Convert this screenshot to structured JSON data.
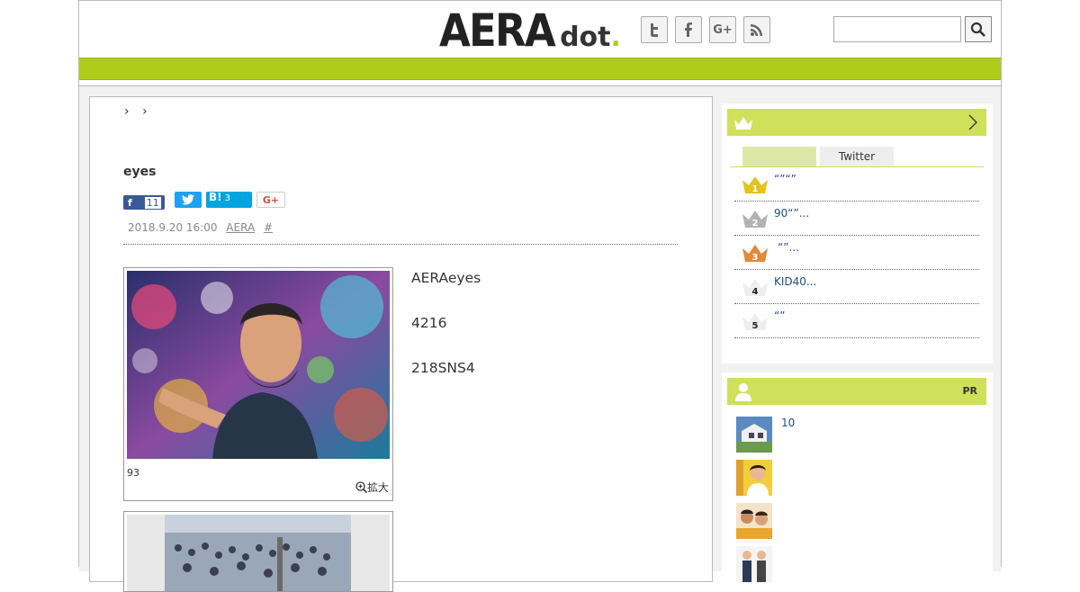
{
  "header": {
    "logo_main": "AERA",
    "logo_dot": "dot",
    "logo_period": ".",
    "social": [
      {
        "icon": "twitter-icon",
        "glyph": "t"
      },
      {
        "icon": "facebook-icon",
        "glyph": "f"
      },
      {
        "icon": "google-plus-icon",
        "glyph": "G+"
      },
      {
        "icon": "rss-icon",
        "glyph": "rss"
      }
    ],
    "search": {
      "placeholder": "",
      "value": ""
    }
  },
  "colors": {
    "accent_green": "#b0cc1a",
    "sidebar_green": "#cfe05a",
    "link_blue": "#1f4e8a"
  },
  "breadcrumbs": [
    "›",
    "›"
  ],
  "article": {
    "title": "eyes",
    "share": {
      "facebook_count": "11",
      "hatena_label": "B!",
      "hatena_count": "3",
      "gplus_label": "G+"
    },
    "date": "2018.9.20 16:00",
    "source": "AERA",
    "tag": "#",
    "photo_caption": "93",
    "zoom_label": "拡大",
    "paragraphs": [
      "AERAeyes",
      "\n4216",
      "218SNS4"
    ]
  },
  "sidebar": {
    "ranking_tabs": [
      "",
      "Twitter"
    ],
    "ranking": [
      {
        "rank": "1",
        "text": "“”“”"
      },
      {
        "rank": "2",
        "text": "90“”..."
      },
      {
        "rank": "3",
        "text": "“”..."
      },
      {
        "rank": "4",
        "text": "KID40..."
      },
      {
        "rank": "5",
        "text": "“”"
      }
    ],
    "pr_label": "PR",
    "pr_items": [
      {
        "text": "10"
      }
    ]
  }
}
